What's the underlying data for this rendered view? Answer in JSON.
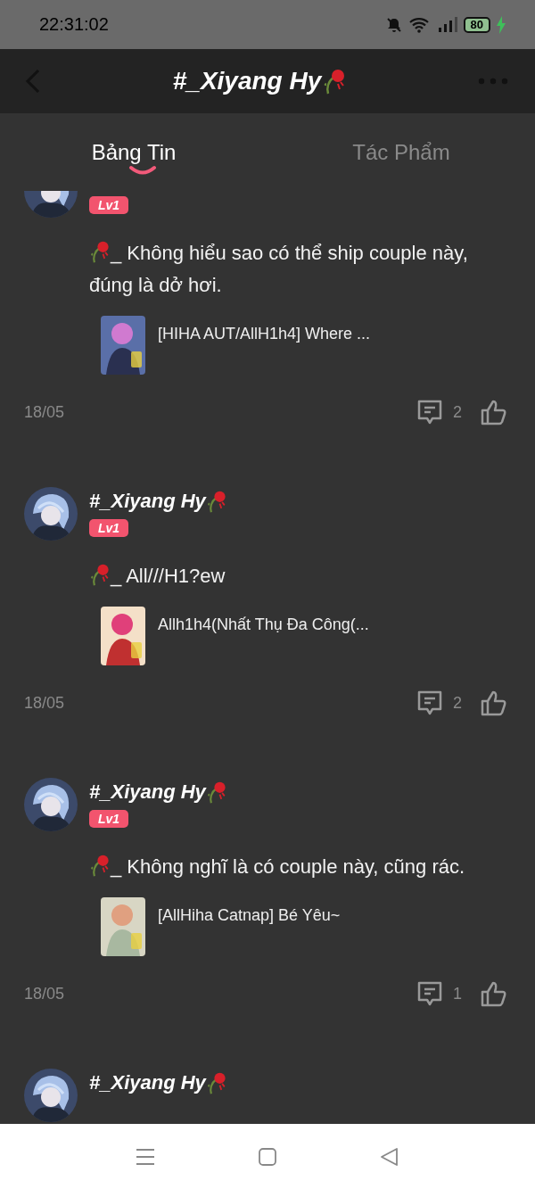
{
  "status_bar": {
    "time": "22:31:02",
    "battery": "80"
  },
  "header": {
    "title": "#_Xiyang Hy"
  },
  "tabs": [
    {
      "label": "Bảng Tin",
      "selected": true
    },
    {
      "label": "Tác Phẩm",
      "selected": false
    }
  ],
  "posts": [
    {
      "badge": "Lv1",
      "text": "_ Không hiểu sao có thể ship couple này, đúng là dở hơi.",
      "attachment": {
        "title": "[HIHA AUT/AllH1h4] Where ..."
      },
      "date": "18/05",
      "comments": "2"
    },
    {
      "author": "#_Xiyang Hy",
      "badge": "Lv1",
      "text": "_ All///H1?ew",
      "attachment": {
        "title": "Allh1h4(Nhất Thụ Đa Công(..."
      },
      "date": "18/05",
      "comments": "2"
    },
    {
      "author": "#_Xiyang Hy",
      "badge": "Lv1",
      "text": "_ Không nghĩ là có couple này, cũng rác.",
      "attachment": {
        "title": "[AllHiha Catnap] Bé Yêu~"
      },
      "date": "18/05",
      "comments": "1"
    },
    {
      "author": "#_Xiyang Hy"
    }
  ]
}
